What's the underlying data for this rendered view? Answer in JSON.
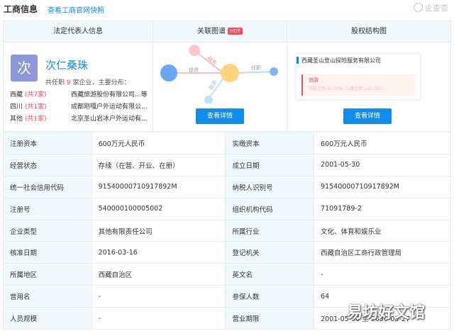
{
  "header": {
    "title": "工商信息",
    "link": "查看工商官网快照",
    "watermark": "企查查"
  },
  "cards": {
    "legal_rep": {
      "title": "法定代表人信息",
      "avatar_char": "次",
      "name": "次仁桑珠",
      "summary_prefix": "共任职",
      "summary_count": "9",
      "summary_suffix": "家企业，主要分布：",
      "regions": [
        {
          "region": "西藏",
          "count": "(共7家)",
          "company": "西藏旅游股份有限公司...等"
        },
        {
          "region": "四川",
          "count": "(共1家)",
          "company": "成都刚嘎户外运动有限公..."
        },
        {
          "region": "其他",
          "count": "(共1家)",
          "company": "北京圣山岩冰户外运动有..."
        }
      ]
    },
    "related_graph": {
      "title": "关联图谱",
      "badge": "HOT",
      "edge_labels": [
        "投资",
        "投资",
        "任职",
        "投资"
      ],
      "button": "查看详情"
    },
    "equity": {
      "title": "股权结构图",
      "company": "西藏圣山登山探险服务有限公司",
      "holder": "旅游",
      "detail_pct": "持股比例 40.00%",
      "detail_amt": "认缴金额 240.00万",
      "button": "查看详情"
    }
  },
  "info_rows": [
    [
      "注册资本",
      "600万元人民币",
      "实缴资本",
      "600万元人民币"
    ],
    [
      "经营状态",
      "存续（在营、开业、在册）",
      "成立日期",
      "2001-05-30"
    ],
    [
      "统一社会信用代码",
      "91540000710917892M",
      "纳税人识别号",
      "91540000710917892M"
    ],
    [
      "注册号",
      "540000100005002",
      "组织机构代码",
      "71091789-2"
    ],
    [
      "企业类型",
      "其他有限责任公司",
      "所属行业",
      "文化、体育和娱乐业"
    ],
    [
      "核准日期",
      "2016-03-16",
      "登记机关",
      "西藏自治区工商行政管理局"
    ],
    [
      "所属地区",
      "西藏自治区",
      "英文名",
      "-"
    ],
    [
      "曾用名",
      "-",
      "参保人数",
      "64"
    ],
    [
      "人员规模",
      "-",
      "营业期限",
      "2001-05-30 至 2030-05-27"
    ]
  ],
  "overlay_watermark": "易坊好文馆",
  "colors": {
    "accent": "#128bed",
    "hot": "#fd485e",
    "label_bg": "#f2f9fc",
    "avatar": "#8e97d8"
  }
}
